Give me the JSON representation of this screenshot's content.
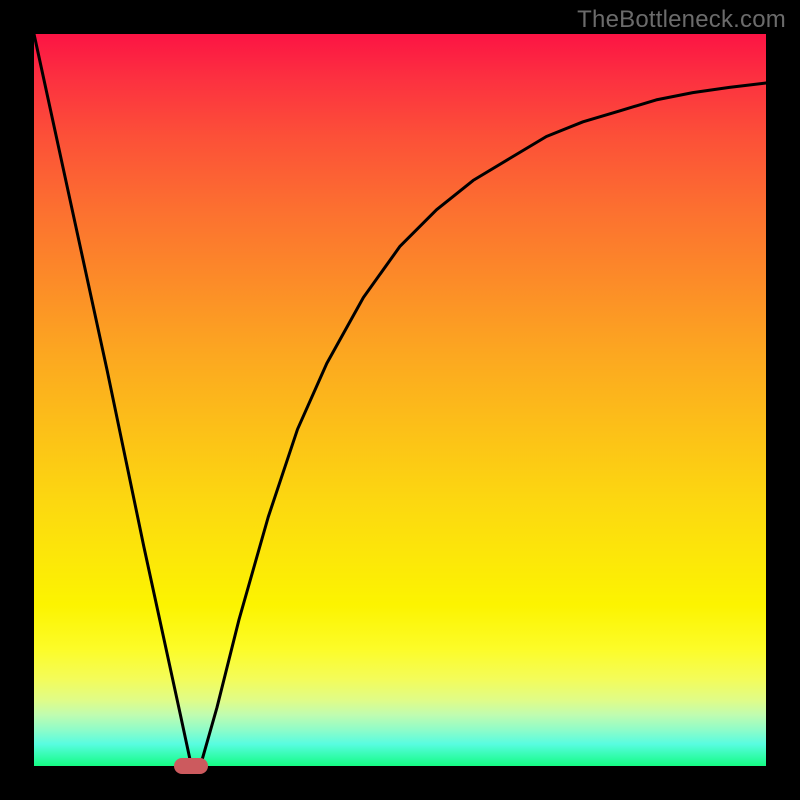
{
  "watermark": "TheBottleneck.com",
  "colors": {
    "frame": "#000000",
    "curve_stroke": "#000000",
    "marker_fill": "#cc5a5e",
    "gradient_top": "#fc1444",
    "gradient_bottom": "#14fc84"
  },
  "chart_data": {
    "type": "line",
    "title": "",
    "xlabel": "",
    "ylabel": "",
    "xlim": [
      0,
      100
    ],
    "ylim": [
      0,
      100
    ],
    "note": "No axis ticks or numeric labels are visible. X and Y are normalized 0–100. The curve is read off the image; values are approximate.",
    "series": [
      {
        "name": "curve",
        "x": [
          0,
          5,
          10,
          15,
          20,
          21.5,
          23,
          25,
          28,
          32,
          36,
          40,
          45,
          50,
          55,
          60,
          65,
          70,
          75,
          80,
          85,
          90,
          95,
          100
        ],
        "y": [
          100,
          77,
          54,
          30,
          7,
          0,
          1,
          8,
          20,
          34,
          46,
          55,
          64,
          71,
          76,
          80,
          83,
          86,
          88,
          89.5,
          91,
          92,
          92.7,
          93.3
        ]
      }
    ],
    "marker": {
      "x": 21.5,
      "y": 0
    }
  }
}
